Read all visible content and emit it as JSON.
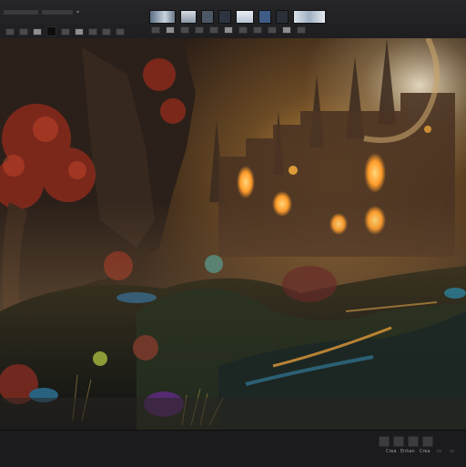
{
  "bottom_bar": {
    "labels": [
      "Crea",
      "Enhan",
      "Crea"
    ]
  },
  "image_viewer": {
    "content": "fantasy-castle-landscape"
  },
  "colors": {
    "toolbar_bg": "#242426",
    "viewer_bg": "#1a1410",
    "window_glow": "#ffb43c"
  }
}
